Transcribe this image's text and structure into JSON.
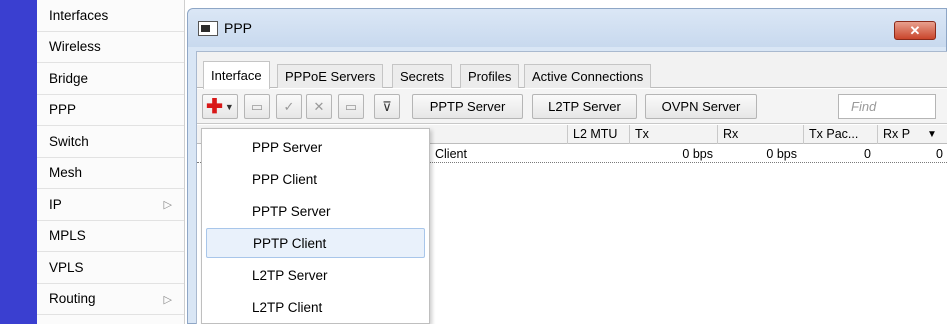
{
  "sidebar": {
    "items": [
      {
        "label": "Interfaces",
        "has_submenu": false
      },
      {
        "label": "Wireless",
        "has_submenu": false
      },
      {
        "label": "Bridge",
        "has_submenu": false
      },
      {
        "label": "PPP",
        "has_submenu": false
      },
      {
        "label": "Switch",
        "has_submenu": false
      },
      {
        "label": "Mesh",
        "has_submenu": false
      },
      {
        "label": "IP",
        "has_submenu": true
      },
      {
        "label": "MPLS",
        "has_submenu": false
      },
      {
        "label": "VPLS",
        "has_submenu": false
      },
      {
        "label": "Routing",
        "has_submenu": true
      }
    ]
  },
  "window": {
    "title": "PPP",
    "close_label": "✕"
  },
  "tabs": [
    "Interface",
    "PPPoE Servers",
    "Secrets",
    "Profiles",
    "Active Connections"
  ],
  "active_tab": "Interface",
  "toolbar": {
    "pptp_server": "PPTP Server",
    "l2tp_server": "L2TP Server",
    "ovpn_server": "OVPN Server",
    "find_placeholder": "Find"
  },
  "table": {
    "columns": [
      "L2 MTU",
      "Tx",
      "Rx",
      "Tx Pac...",
      "Rx P"
    ],
    "rows": [
      {
        "type": "Client",
        "l2mtu": "",
        "tx": "0 bps",
        "rx": "0 bps",
        "tx_packets": "0",
        "rx_packets": "0"
      }
    ]
  },
  "dropdown": {
    "items": [
      "PPP Server",
      "PPP Client",
      "PPTP Server",
      "PPTP Client",
      "L2TP Server",
      "L2TP Client"
    ],
    "highlighted": "PPTP Client"
  },
  "colors": {
    "accent_strip": "#3a3fd0",
    "close_button": "#c9452b",
    "add_icon": "#d81818",
    "highlight": "#e9f1fb"
  }
}
